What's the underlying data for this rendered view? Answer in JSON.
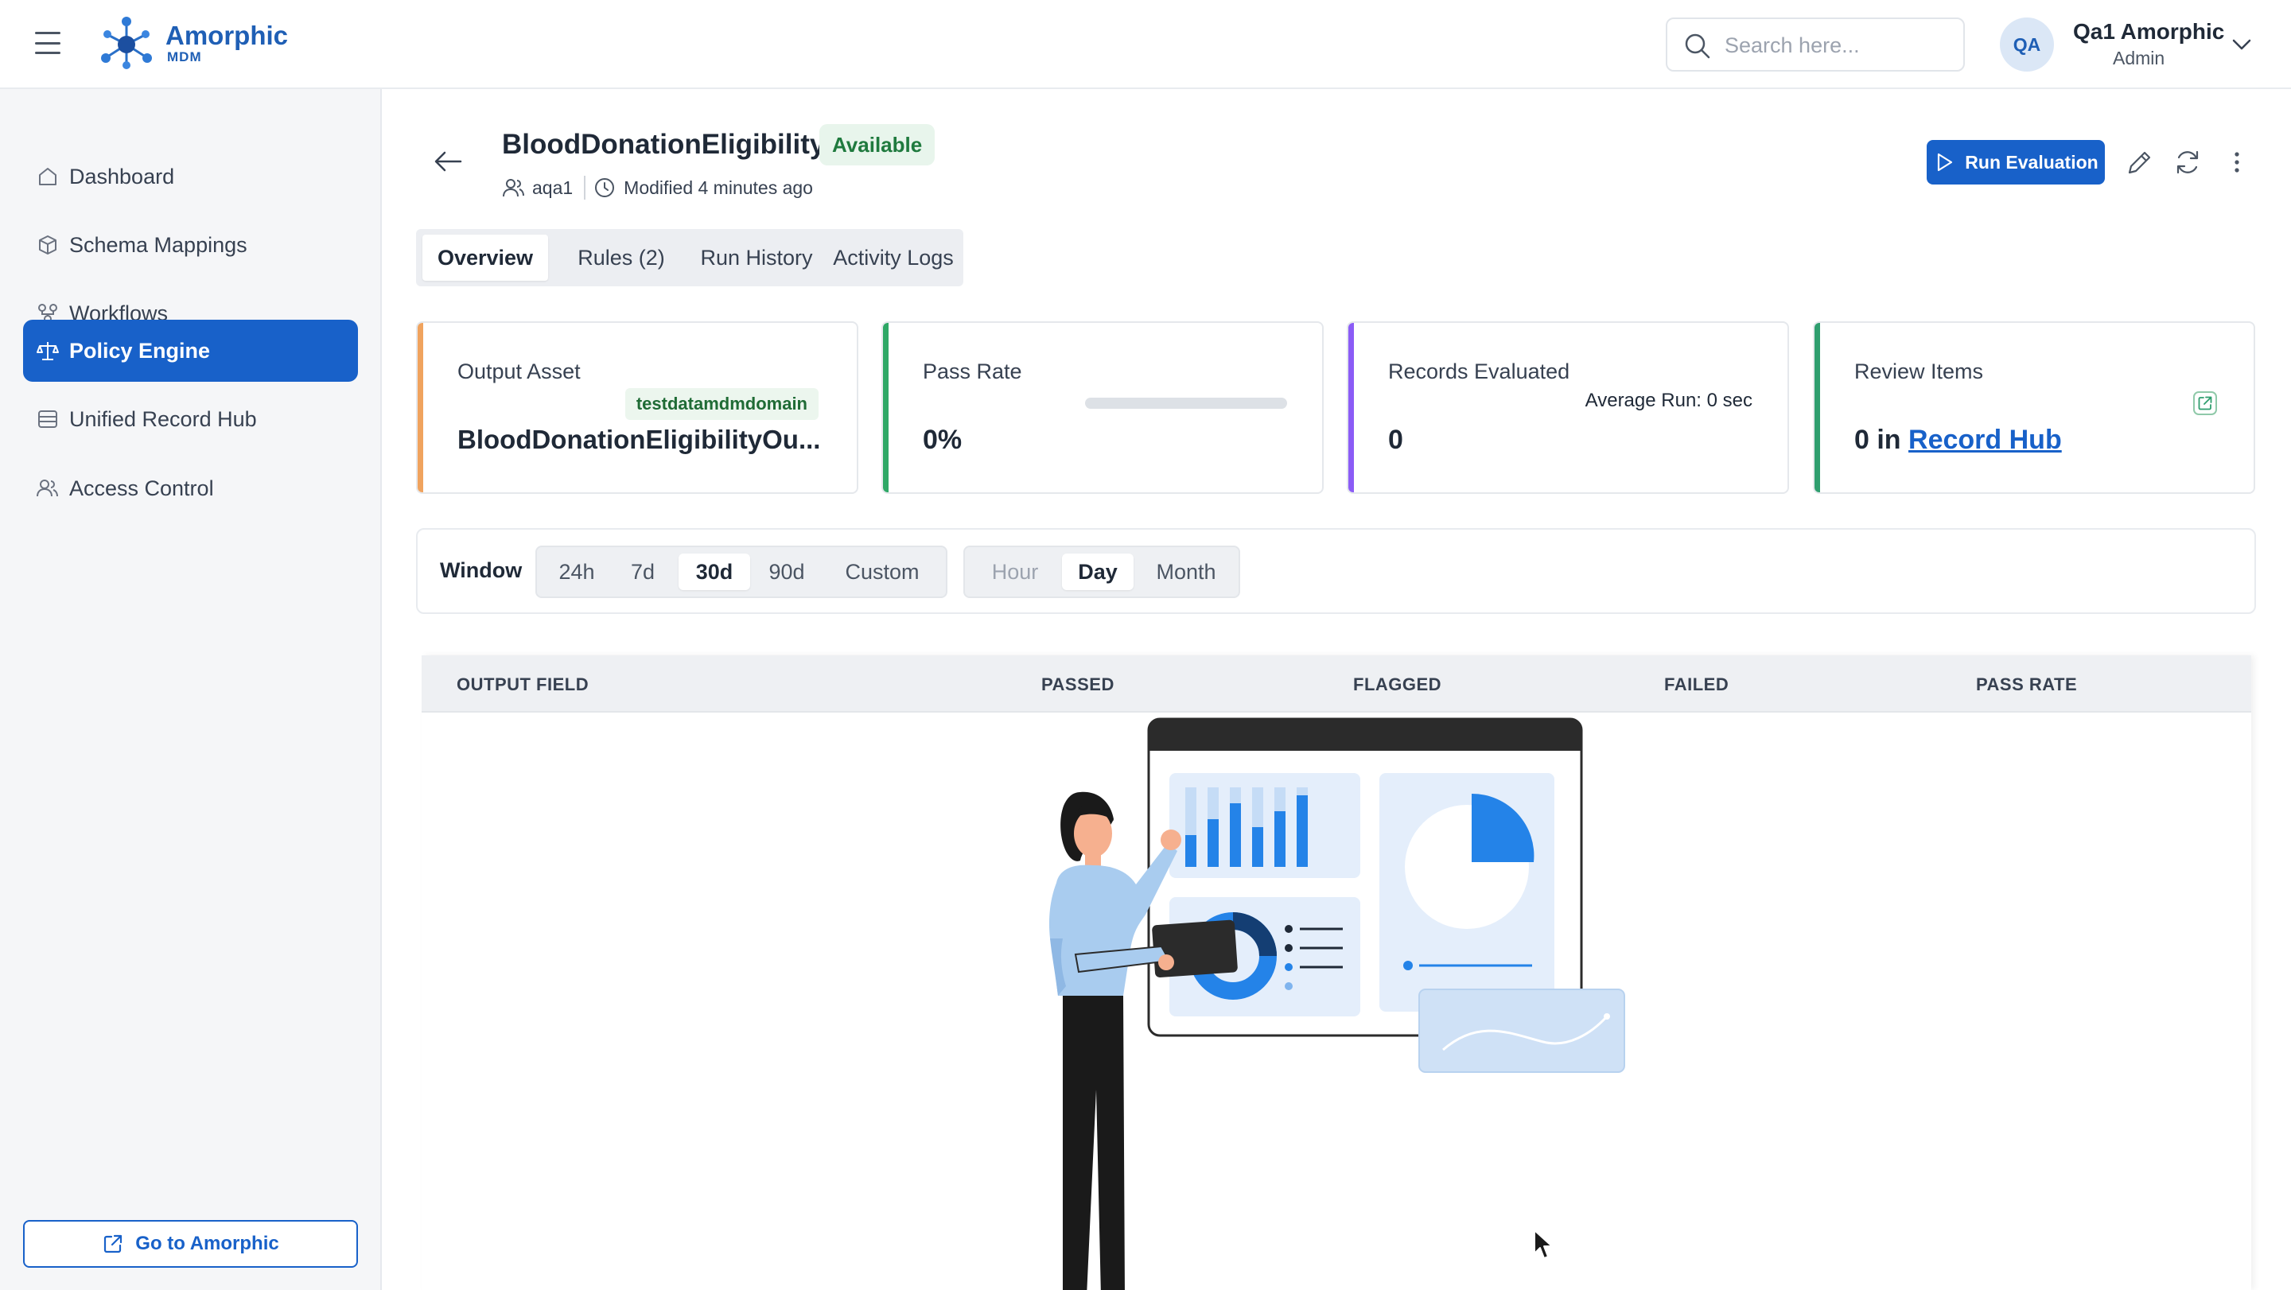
{
  "app": {
    "brand_name": "Amorphic",
    "brand_sub": "MDM",
    "search_placeholder": "Search here...",
    "user": {
      "initials": "QA",
      "name": "Qa1 Amorphic",
      "role": "Admin"
    }
  },
  "sidebar": {
    "items": [
      {
        "label": "Dashboard",
        "icon": "home-icon",
        "active": false
      },
      {
        "label": "Schema Mappings",
        "icon": "cube-icon",
        "active": false
      },
      {
        "label": "Workflows",
        "icon": "workflow-icon",
        "active": false
      },
      {
        "label": "Policy Engine",
        "icon": "scale-icon",
        "active": true
      },
      {
        "label": "Unified Record Hub",
        "icon": "database-icon",
        "active": false
      },
      {
        "label": "Access Control",
        "icon": "users-icon",
        "active": false
      }
    ],
    "footer_button": "Go to Amorphic"
  },
  "page": {
    "title": "BloodDonationEligibility",
    "status": "Available",
    "owner": "aqa1",
    "modified": "Modified 4 minutes ago",
    "run_button": "Run Evaluation",
    "tabs": [
      {
        "label": "Overview",
        "active": true
      },
      {
        "label": "Rules (2)",
        "active": false
      },
      {
        "label": "Run History",
        "active": false
      },
      {
        "label": "Activity Logs",
        "active": false
      }
    ]
  },
  "cards": {
    "output_asset": {
      "label": "Output Asset",
      "tag": "testdatamdmdomain",
      "value": "BloodDonationEligibilityOu..."
    },
    "pass_rate": {
      "label": "Pass Rate",
      "value": "0%",
      "progress_fraction": 0.0
    },
    "records_evaluated": {
      "label": "Records Evaluated",
      "avg_run": "Average Run: 0 sec",
      "value": "0"
    },
    "review_items": {
      "label": "Review Items",
      "value_prefix": "0 in",
      "link": "Record Hub"
    }
  },
  "filters": {
    "window_label": "Window",
    "windows": [
      {
        "label": "24h",
        "active": false
      },
      {
        "label": "7d",
        "active": false
      },
      {
        "label": "30d",
        "active": true
      },
      {
        "label": "90d",
        "active": false
      },
      {
        "label": "Custom",
        "active": false
      }
    ],
    "granularity": [
      {
        "label": "Hour",
        "active": false,
        "disabled": true
      },
      {
        "label": "Day",
        "active": true,
        "disabled": false
      },
      {
        "label": "Month",
        "active": false,
        "disabled": false
      }
    ]
  },
  "table": {
    "columns": [
      "OUTPUT FIELD",
      "PASSED",
      "FLAGGED",
      "FAILED",
      "PASS RATE"
    ],
    "rows": []
  },
  "colors": {
    "primary": "#1861c9",
    "accent_orange": "#f0a35e",
    "accent_green": "#2fa866",
    "accent_purple": "#8b5cf6",
    "accent_teal": "#2f9e6e"
  }
}
